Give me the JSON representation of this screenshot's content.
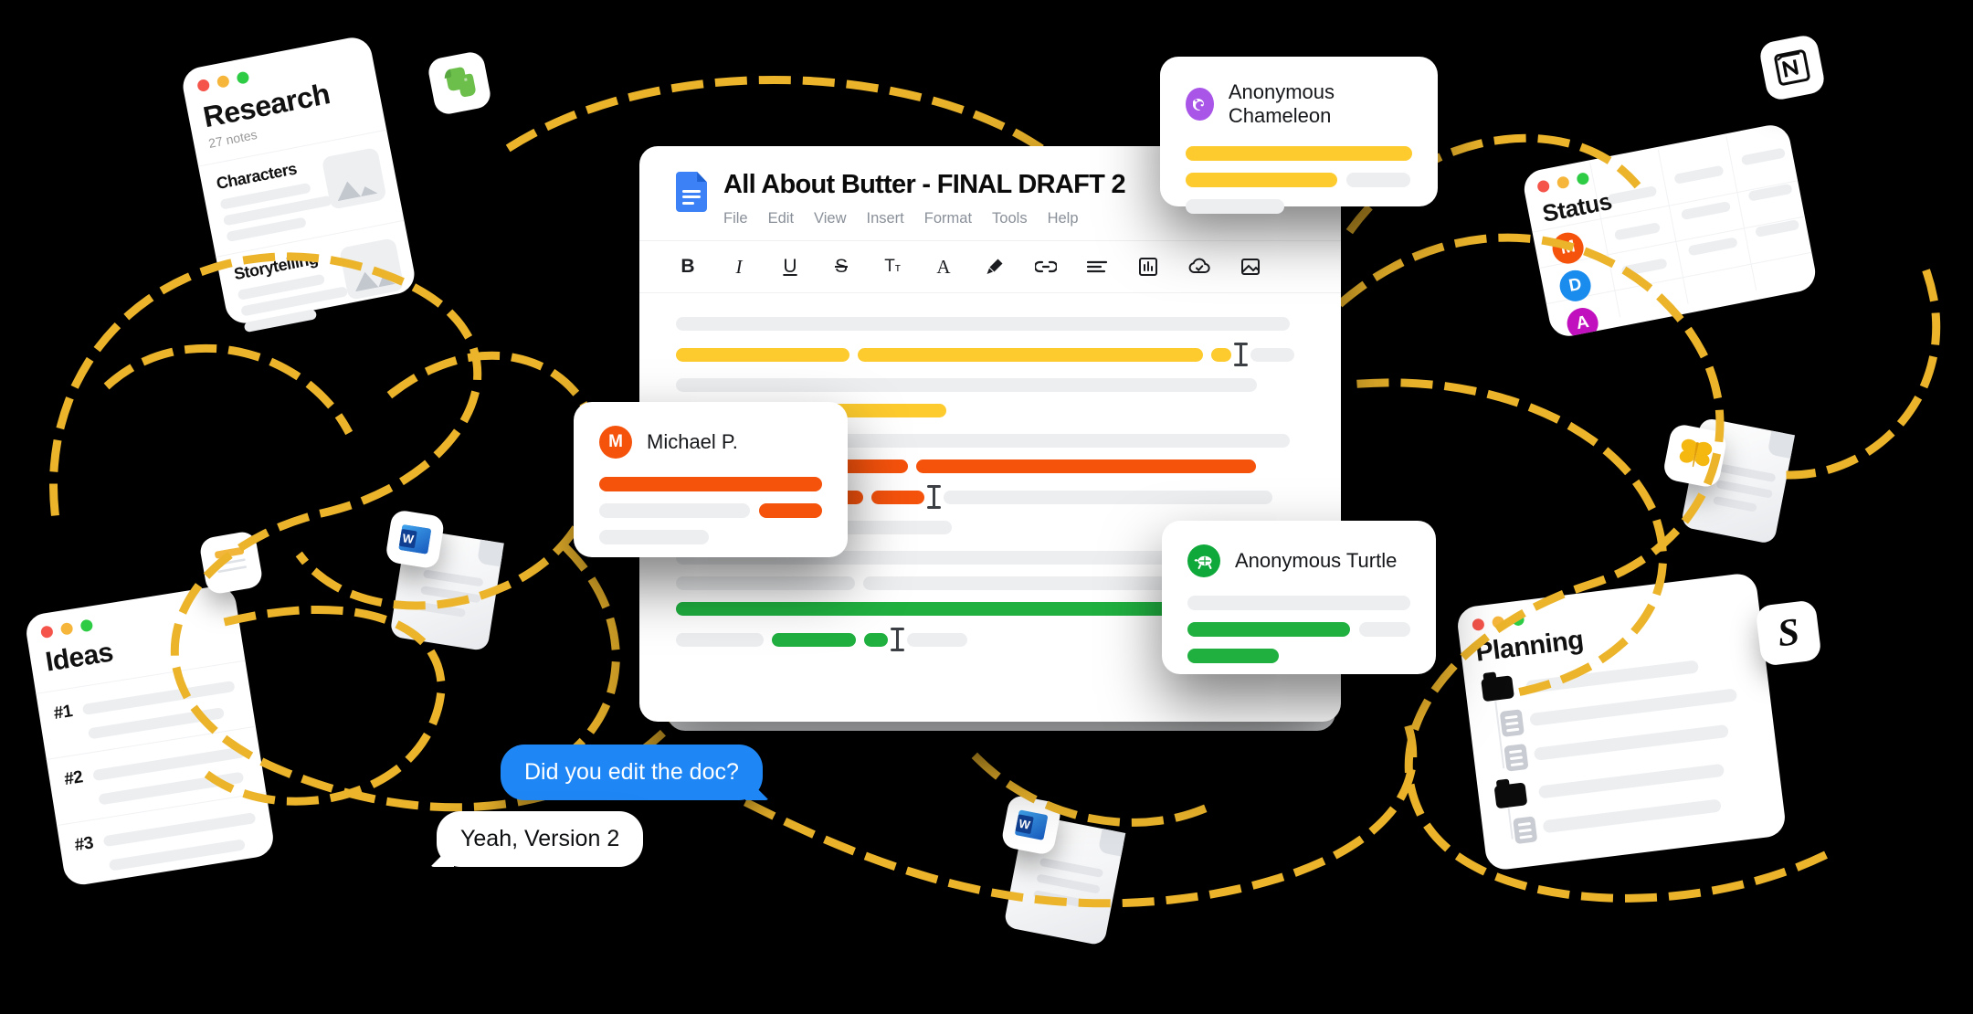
{
  "scene": {
    "background_color": "#000000",
    "connector_color": "#EBB42B",
    "connector_style": "dashed"
  },
  "document_window": {
    "title": "All About Butter - FINAL DRAFT 2",
    "app_icon": "google-docs-icon",
    "menu": [
      "File",
      "Edit",
      "View",
      "Insert",
      "Format",
      "Tools",
      "Help"
    ],
    "toolbar": [
      {
        "name": "bold-icon",
        "glyph": "B"
      },
      {
        "name": "italic-icon",
        "glyph": "I"
      },
      {
        "name": "underline-icon",
        "glyph": "U"
      },
      {
        "name": "strikethrough-icon",
        "glyph": "S"
      },
      {
        "name": "font-size-icon",
        "glyph": "Tт"
      },
      {
        "name": "text-color-icon",
        "glyph": "A"
      },
      {
        "name": "highlighter-icon",
        "glyph": "✐"
      },
      {
        "name": "link-icon",
        "glyph": "⚭"
      },
      {
        "name": "align-left-icon",
        "glyph": "≡"
      },
      {
        "name": "insert-chart-icon",
        "glyph": "Ὄa"
      },
      {
        "name": "cloud-saved-icon",
        "glyph": "☁"
      },
      {
        "name": "insert-image-icon",
        "glyph": "Ὓb"
      }
    ],
    "highlight_colors": {
      "yellow": "#FDCB2E",
      "orange": "#F5520C",
      "green": "#20B040",
      "placeholder": "#ECEEF0"
    }
  },
  "collaborators": [
    {
      "name": "Anonymous Chameleon",
      "avatar_icon": "chameleon-icon",
      "avatar_color": "#A855E8",
      "highlight_color": "#FDCB2E"
    },
    {
      "name": "Michael P.",
      "avatar_initial": "M",
      "avatar_color": "#F5520C",
      "highlight_color": "#F5520C"
    },
    {
      "name": "Anonymous Turtle",
      "avatar_icon": "turtle-icon",
      "avatar_color": "#0FA83A",
      "highlight_color": "#20B040"
    }
  ],
  "cards": {
    "research": {
      "title": "Research",
      "subtitle": "27 notes",
      "app_icon": "evernote-icon",
      "sections": [
        "Characters",
        "Storytelling"
      ]
    },
    "ideas": {
      "title": "Ideas",
      "app_icon": "sticky-note-icon",
      "items": [
        "#1",
        "#2",
        "#3"
      ]
    },
    "status": {
      "title": "Status",
      "app_icon": "notion-icon",
      "avatars": [
        {
          "initial": "M",
          "color": "#F5520C"
        },
        {
          "initial": "D",
          "color": "#1A8CEE"
        },
        {
          "initial": "A",
          "color": "#C110BE"
        }
      ]
    },
    "planning": {
      "title": "Planning",
      "app_icon": "scrivener-icon",
      "app_icon_glyph": "S"
    }
  },
  "chat": {
    "outgoing": "Did you edit the doc?",
    "incoming": "Yeah, Version 2",
    "outgoing_color": "#1F87F5",
    "incoming_color": "#FFFFFF"
  },
  "floating_files": [
    {
      "name": "word-document-icon",
      "glyph": "W",
      "color": "#2B5797"
    },
    {
      "name": "word-document-icon",
      "glyph": "W",
      "color": "#2B5797"
    },
    {
      "name": "ulysses-butterfly-icon",
      "glyph": "❦",
      "color": "#F4B811"
    }
  ]
}
